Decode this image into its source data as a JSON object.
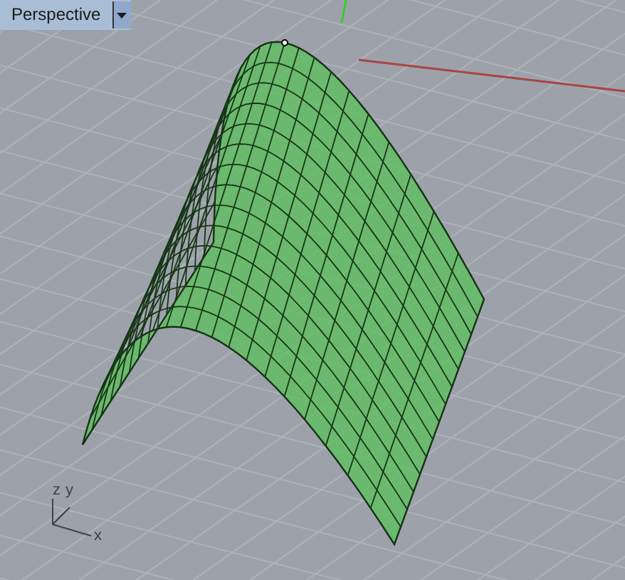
{
  "viewport": {
    "title": "Perspective"
  },
  "axis_labels": [
    "z",
    "y",
    "x"
  ]
}
